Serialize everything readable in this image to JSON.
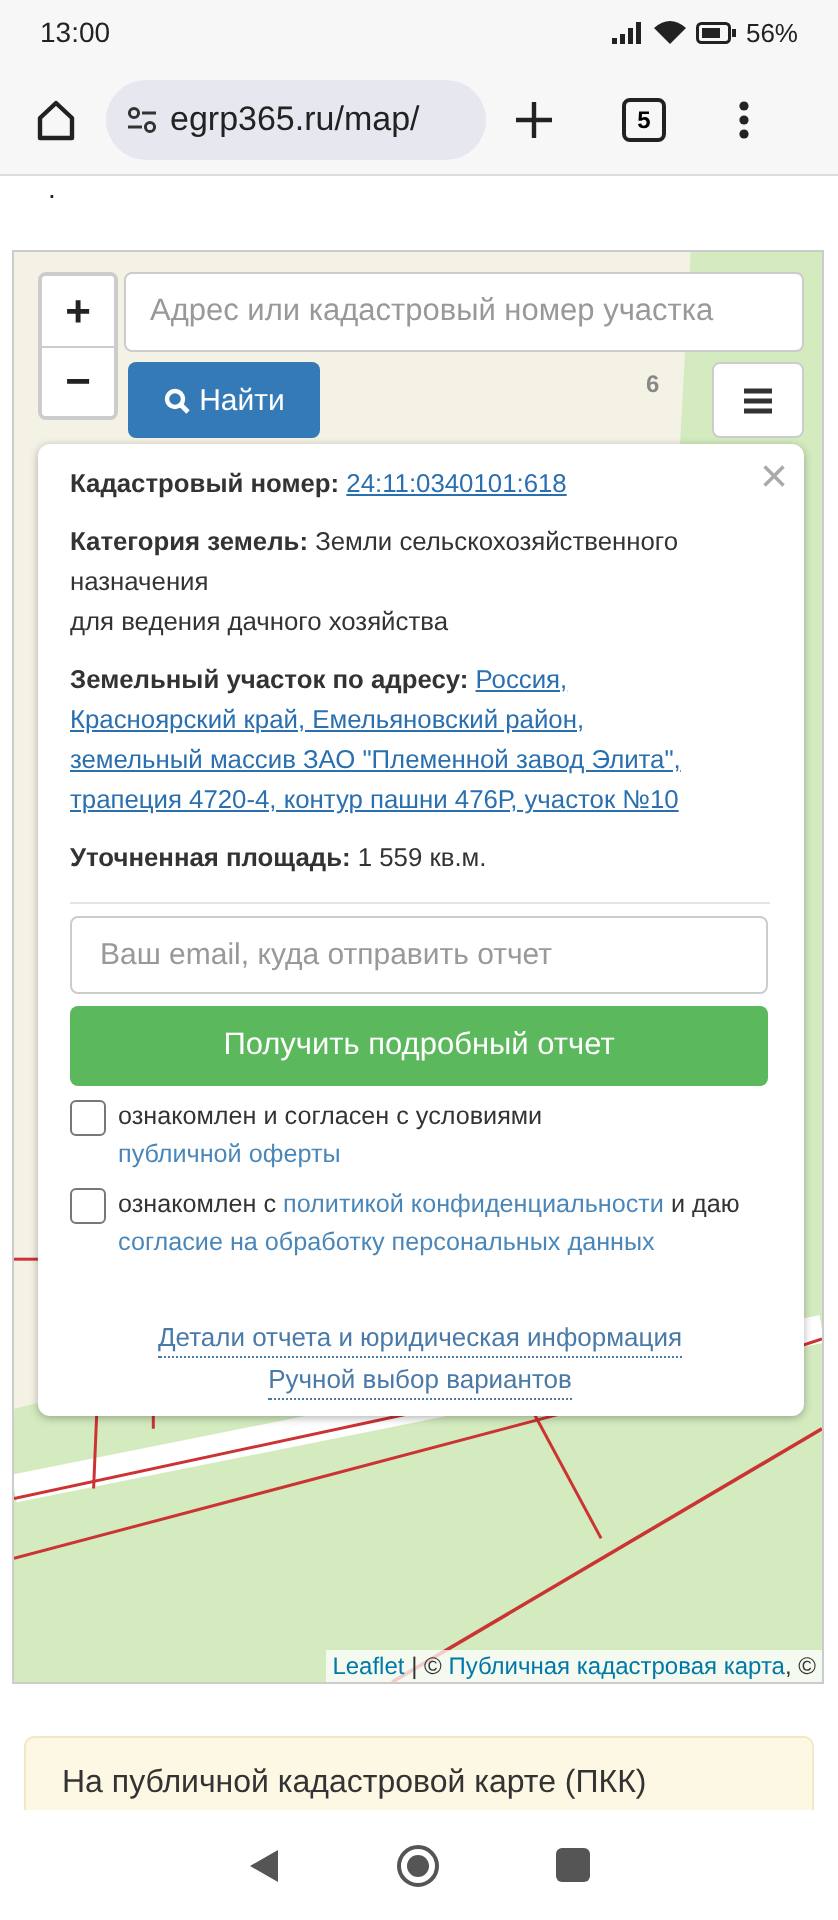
{
  "status_bar": {
    "time": "13:00",
    "battery": "56%"
  },
  "browser": {
    "url": "egrp365.ru/map/",
    "tab_count": "5"
  },
  "page_fragment": ".",
  "map": {
    "zoom_in": "+",
    "zoom_out": "−",
    "search": {
      "placeholder": "Адрес или кадастровый номер участка"
    },
    "find_button": "Найти",
    "cluster_count": "6",
    "popup": {
      "close": "×",
      "fields": [
        {
          "label": "Кадастровый номер:",
          "kind": "link",
          "lines": [
            "24:11:0340101:618"
          ]
        },
        {
          "label": "Категория земель:",
          "kind": "text",
          "lines": [
            "Земли сельскохозяйственного назначения",
            "для ведения дачного хозяйства"
          ]
        },
        {
          "label": "Земельный участок по адресу:",
          "kind": "link",
          "lines": [
            "Россия,",
            "Красноярский край, Емельяновский район,",
            "земельный массив ЗАО \"Племенной завод Элита\",",
            "трапеция 4720-4, контур пашни 476Р, участок №10"
          ]
        },
        {
          "label": "Уточненная площадь:",
          "kind": "text",
          "lines": [
            "1 559 кв.м."
          ]
        }
      ],
      "email": {
        "placeholder": "Ваш email, куда отправить отчет"
      },
      "submit_button": "Получить подробный отчет",
      "agreements": [
        {
          "checked": false,
          "parts": [
            {
              "text": "ознакомлен и согласен с условиями ",
              "link": false
            },
            {
              "text": "публичной оферты",
              "link": true
            }
          ]
        },
        {
          "checked": false,
          "parts": [
            {
              "text": "ознакомлен с ",
              "link": false
            },
            {
              "text": "политикой конфиденциальности",
              "link": true
            },
            {
              "text": " и даю ",
              "link": false
            },
            {
              "text": "согласие на обработку персональных данных",
              "link": true
            }
          ]
        }
      ],
      "links": [
        "Детали отчета и юридическая информация",
        "Ручной выбор вариантов"
      ]
    },
    "attribution": [
      {
        "text": "Leaflet",
        "link": true
      },
      {
        "text": " | © ",
        "link": false
      },
      {
        "text": "Публичная кадастровая карта",
        "link": true
      },
      {
        "text": ", ©",
        "link": false
      }
    ]
  },
  "notice": {
    "text": "На публичной кадастровой карте (ПКК)"
  }
}
